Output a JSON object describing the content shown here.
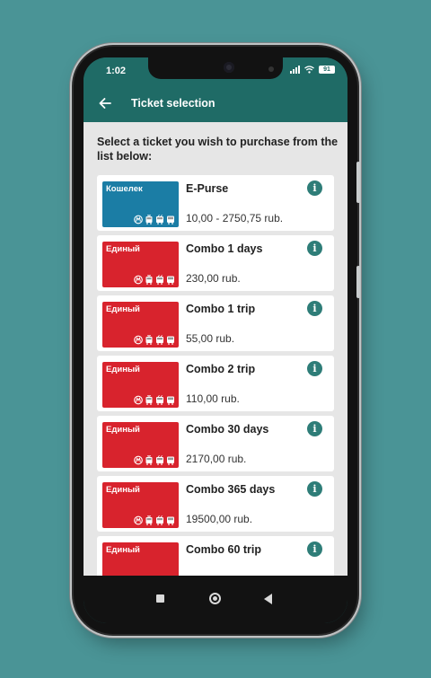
{
  "status": {
    "time": "1:02",
    "battery": "91"
  },
  "appbar": {
    "title": "Ticket selection",
    "back_icon": "arrow-left-icon"
  },
  "instruction": "Select a ticket you wish to purchase from the list below:",
  "tickets": [
    {
      "card_label": "Кошелек",
      "card_color": "#1b7da5",
      "name": "E-Purse",
      "price": "10,00 - 2750,75 rub."
    },
    {
      "card_label": "Единый",
      "card_color": "#d8232d",
      "name": "Combo 1 days",
      "price": "230,00 rub."
    },
    {
      "card_label": "Единый",
      "card_color": "#d8232d",
      "name": "Combo 1 trip",
      "price": "55,00 rub."
    },
    {
      "card_label": "Единый",
      "card_color": "#d8232d",
      "name": "Combo 2 trip",
      "price": "110,00 rub."
    },
    {
      "card_label": "Единый",
      "card_color": "#d8232d",
      "name": "Combo 30 days",
      "price": "2170,00 rub."
    },
    {
      "card_label": "Единый",
      "card_color": "#d8232d",
      "name": "Combo 365 days",
      "price": "19500,00 rub."
    },
    {
      "card_label": "Единый",
      "card_color": "#d8232d",
      "name": "Combo 60 trip",
      "price": ""
    }
  ],
  "info_symbol": "i",
  "card_transport_icons": [
    "metro-icon",
    "tram-icon",
    "trolleybus-icon",
    "bus-icon"
  ],
  "colors": {
    "primary": "#1f6b66",
    "info": "#2e7d78",
    "background": "#e6e6e6"
  }
}
